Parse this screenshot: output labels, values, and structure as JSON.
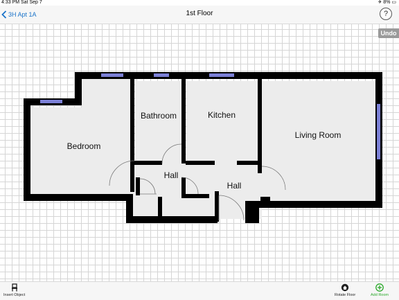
{
  "statusbar": {
    "time": "4:33 PM  Sat Sep 7",
    "battery": "✈ 8% ▭"
  },
  "nav": {
    "back_label": "3H Apt 1A",
    "title": "1st Floor",
    "help_label": "?"
  },
  "canvas": {
    "undo_label": "Undo"
  },
  "rooms": {
    "bedroom": "Bedroom",
    "bathroom": "Bathroom",
    "kitchen": "Kitchen",
    "living_room": "Living Room",
    "hall_1": "Hall",
    "hall_2": "Hall"
  },
  "toolbar": {
    "insert_object": "Insert Object",
    "rotate_floor": "Rotate Floor",
    "add_room": "Add Room"
  },
  "colors": {
    "accent": "#1a73c9",
    "wall": "#000000",
    "window": "#7b80d6",
    "room_fill": "#ececec",
    "add": "#2aa82a"
  }
}
